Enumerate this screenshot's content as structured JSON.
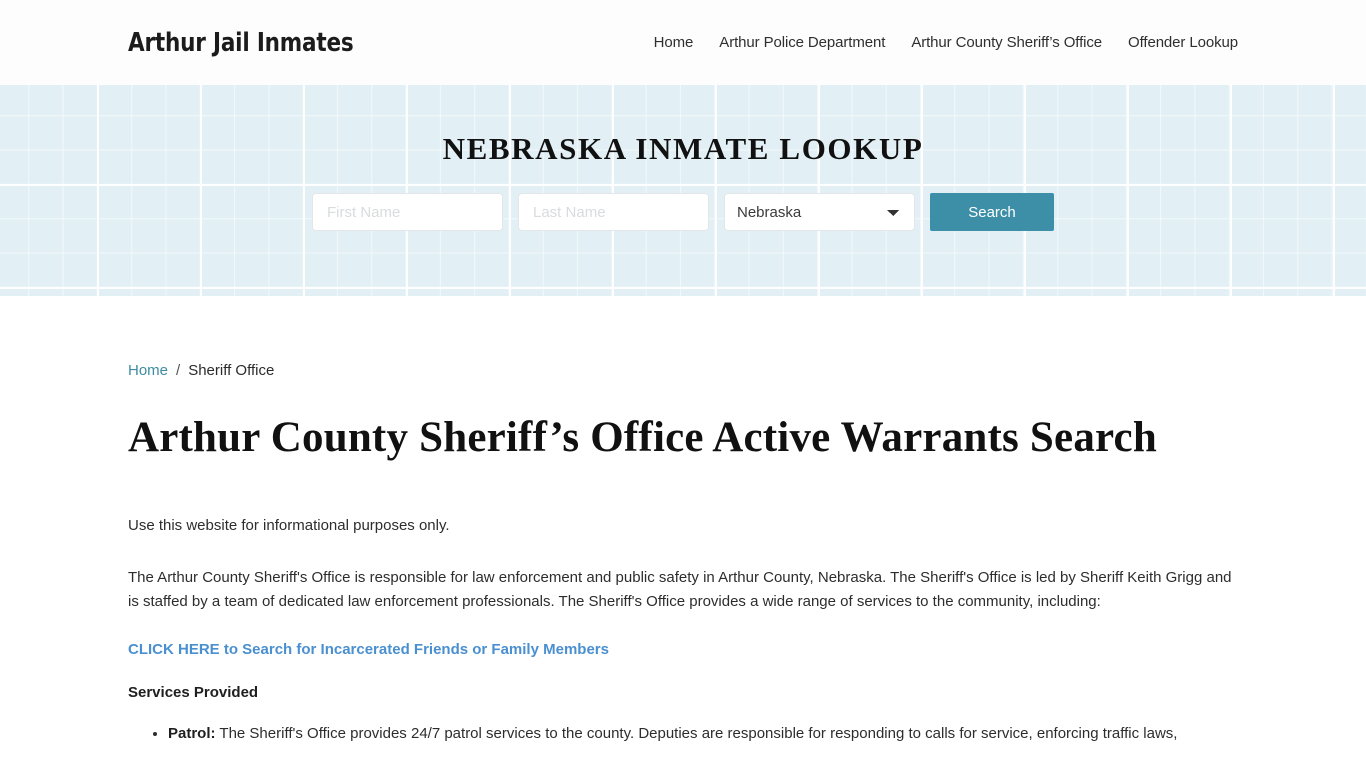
{
  "header": {
    "brand": "Arthur Jail Inmates",
    "nav": [
      {
        "label": "Home"
      },
      {
        "label": "Arthur Police Department"
      },
      {
        "label": "Arthur County Sheriff’s Office"
      },
      {
        "label": "Offender Lookup"
      }
    ]
  },
  "hero": {
    "title": "NEBRASKA INMATE LOOKUP",
    "background_color": "#e2f0f5",
    "form": {
      "first_name_placeholder": "First Name",
      "first_name_value": "",
      "last_name_placeholder": "Last Name",
      "last_name_value": "",
      "state_selected": "Nebraska",
      "state_options": [
        "Nebraska"
      ],
      "search_label": "Search",
      "search_color": "#3c8fa6"
    }
  },
  "breadcrumb": {
    "home": "Home",
    "separator": "/",
    "current": "Sheriff Office"
  },
  "main": {
    "page_title": "Arthur County Sheriff’s Office Active Warrants Search",
    "disclaimer": "Use this website for informational purposes only.",
    "intro": "The Arthur County Sheriff's Office is responsible for law enforcement and public safety in Arthur County, Nebraska. The Sheriff's Office is led by Sheriff Keith Grigg and is staffed by a team of dedicated law enforcement professionals. The Sheriff's Office provides a wide range of services to the community, including:",
    "cta_label": "CLICK HERE to Search for Incarcerated Friends or Family Members",
    "cta_color": "#4a90d0",
    "services_heading": "Services Provided",
    "services": [
      {
        "term": "Patrol:",
        "description": " The Sheriff's Office provides 24/7 patrol services to the county. Deputies are responsible for responding to calls for service, enforcing traffic laws,"
      }
    ]
  }
}
